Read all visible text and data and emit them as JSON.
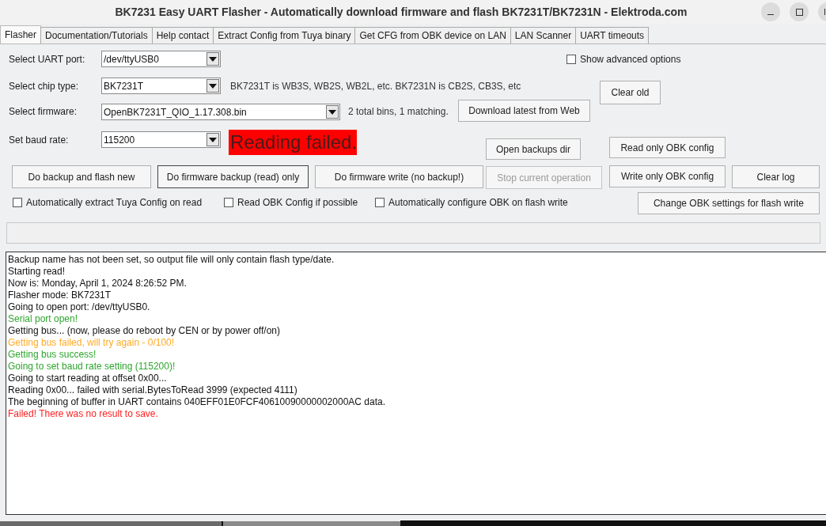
{
  "window": {
    "title": "BK7231 Easy UART Flasher - Automatically download firmware and flash BK7231T/BK7231N  - Elektroda.com"
  },
  "tabs": [
    {
      "label": "Flasher",
      "selected": true
    },
    {
      "label": "Documentation/Tutorials",
      "selected": false
    },
    {
      "label": "Help contact",
      "selected": false
    },
    {
      "label": "Extract Config from Tuya binary",
      "selected": false
    },
    {
      "label": "Get CFG from OBK device on LAN",
      "selected": false
    },
    {
      "label": "LAN Scanner",
      "selected": false
    },
    {
      "label": "UART timeouts",
      "selected": false
    }
  ],
  "uart_port": {
    "label": "Select UART port:",
    "value": "/dev/ttyUSB0"
  },
  "show_advanced": {
    "label": "Show advanced options",
    "checked": false
  },
  "chip_type": {
    "label": "Select chip type:",
    "value": "BK7231T",
    "hint": "BK7231T is WB3S, WB2S, WB2L, etc. BK7231N is CB2S, CB3S, etc"
  },
  "clear_old": {
    "label": "Clear old"
  },
  "firmware": {
    "label": "Select firmware:",
    "value": "OpenBK7231T_QIO_1.17.308.bin",
    "hint": "2 total bins, 1 matching."
  },
  "download": {
    "label": "Download latest from Web"
  },
  "baud_rate": {
    "label": "Set baud rate:",
    "value": "115200"
  },
  "status": {
    "text": "Reading failed."
  },
  "open_backups": {
    "label": "Open backups dir"
  },
  "read_obk": {
    "label": "Read only OBK config"
  },
  "action_buttons": [
    {
      "label": "Do backup and flash new",
      "focused": false,
      "disabled": false
    },
    {
      "label": "Do firmware backup (read) only",
      "focused": true,
      "disabled": false
    },
    {
      "label": "Do firmware write (no backup!)",
      "focused": false,
      "disabled": false
    },
    {
      "label": "Stop current operation",
      "focused": false,
      "disabled": true
    },
    {
      "label": "Write only OBK config",
      "focused": false,
      "disabled": false
    },
    {
      "label": "Clear log",
      "focused": false,
      "disabled": false
    }
  ],
  "options": [
    {
      "label": "Automatically extract Tuya Config on read",
      "checked": false
    },
    {
      "label": "Read OBK Config if possible",
      "checked": false
    },
    {
      "label": "Automatically configure OBK on flash write",
      "checked": false
    }
  ],
  "change_obk": {
    "label": "Change OBK settings for flash write"
  },
  "progress": {
    "level": 0
  },
  "log": [
    {
      "text": "Backup name has not been set, so output file will only contain flash type/date.",
      "color": "#111111"
    },
    {
      "text": "Starting read!",
      "color": "#111111"
    },
    {
      "text": "Now is: Monday, April 1, 2024 8:26:52 PM.",
      "color": "#111111"
    },
    {
      "text": "Flasher mode: BK7231T",
      "color": "#111111"
    },
    {
      "text": "Going to open port: /dev/ttyUSB0.",
      "color": "#111111"
    },
    {
      "text": "Serial port open!",
      "color": "#2ea52e"
    },
    {
      "text": "Getting bus... (now, please do reboot by CEN or by power off/on)",
      "color": "#111111"
    },
    {
      "text": "Getting bus failed, will try again - 0/100!",
      "color": "#ffaa22"
    },
    {
      "text": "Getting bus success!",
      "color": "#2ea52e"
    },
    {
      "text": "Going to set baud rate setting (115200)!",
      "color": "#2ea52e"
    },
    {
      "text": "Going to start reading at offset 0x00...",
      "color": "#111111"
    },
    {
      "text": "Reading 0x00... failed with serial.BytesToRead 3999 (expected 4111)",
      "color": "#111111"
    },
    {
      "text": "The beginning of buffer in UART contains 040EFF01E0FCF40610090000002000AC data.",
      "color": "#111111"
    },
    {
      "text": "Failed! There was no result to save.",
      "color": "#ff2020"
    }
  ]
}
